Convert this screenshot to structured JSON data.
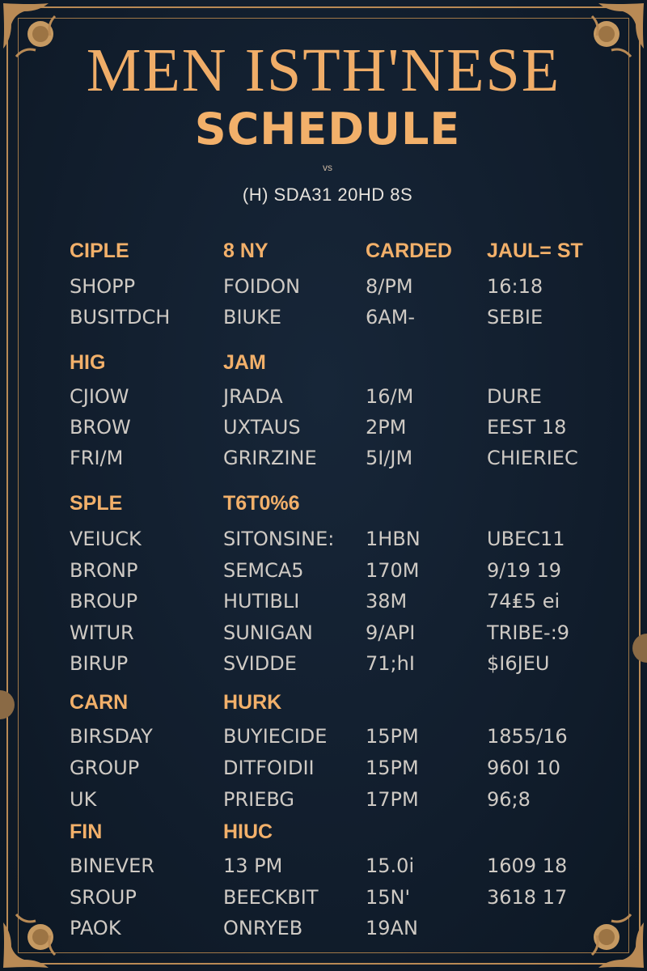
{
  "title": "MEN ISTH'NESE",
  "subtitle": "SCHEDULE",
  "small_text": "vs",
  "date_line": "(H) SDA31 20HD 8S",
  "sections": [
    {
      "headers": [
        "CIPLE",
        "8 NY",
        "CARDED",
        "JAUL= ST"
      ],
      "rows": [
        [
          "SHOPP",
          "FOIDON",
          "8/PM",
          "16:18"
        ],
        [
          "BUSITDCH",
          "BIUKE",
          "6AM-",
          "SEBIE"
        ]
      ]
    },
    {
      "headers": [
        "HIG",
        "JAM",
        "",
        ""
      ],
      "rows": [
        [
          "CJIOW",
          "JRADA",
          "16/M",
          "DURE"
        ],
        [
          "BROW",
          "UXTAUS",
          "2PM",
          "EEST 18"
        ],
        [
          "FRI/M",
          "GRIRZINE",
          "5I/JM",
          "CHIERIEC"
        ]
      ]
    },
    {
      "headers": [
        "SPLE",
        "T6T0%6",
        "",
        ""
      ],
      "rows": [
        [
          "VEIUCK",
          "SITONSINE:",
          "1HBN",
          "UBEC11"
        ],
        [
          "BRONP",
          "SEMCA5",
          "170M",
          "9/19 19"
        ],
        [
          "BROUP",
          "HUTIBLI",
          "38M",
          "74₤5 ei"
        ],
        [
          "WITUR",
          "SUNIGAN",
          "9/API",
          "TRIBE-:9"
        ],
        [
          "BIRUP",
          "SVIDDE",
          "71;hI",
          "$I6JEU"
        ]
      ]
    },
    {
      "headers": [
        "CARN",
        "HURK",
        "",
        ""
      ],
      "rows": [
        [
          "BIRSDAY",
          "BUYIECIDE",
          "15PM",
          "1855/16"
        ],
        [
          "GROUP",
          "DITFOIDII",
          "15PM",
          "960I 10"
        ],
        [
          "UK",
          "PRIEBG",
          "17PM",
          "96;8"
        ]
      ]
    },
    {
      "headers": [
        "FIN",
        "HIUC",
        "",
        ""
      ],
      "rows": [
        [
          "BINEVER",
          "13 PM",
          "15.0i",
          "1609 18"
        ],
        [
          "SROUP",
          "BEECKBIT",
          "15N'",
          "3618 17"
        ],
        [
          "PAOK",
          "ONRYEB",
          "19AN",
          ""
        ]
      ]
    }
  ],
  "colors": {
    "background": "#111d2c",
    "accent": "#f2b06a",
    "text": "#cfcac4",
    "frame": "#b98a55"
  }
}
